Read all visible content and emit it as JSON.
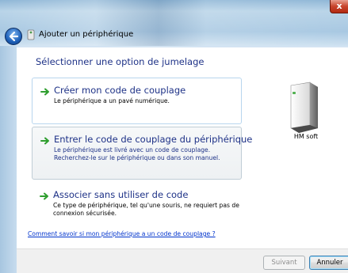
{
  "window": {
    "title": "Ajouter un périphérique",
    "close_glyph": "x"
  },
  "page": {
    "heading": "Sélectionner une option de jumelage"
  },
  "options": [
    {
      "title": "Créer mon code de couplage",
      "desc": "Le périphérique a un pavé numérique."
    },
    {
      "title": "Entrer le code de couplage du périphérique",
      "desc": "Le périphérique est livré avec un code de couplage. Recherchez-le sur le périphérique ou dans son manuel."
    },
    {
      "title": "Associer sans utiliser de code",
      "desc": "Ce type de périphérique, tel qu'une souris, ne requiert pas de connexion sécurisée."
    }
  ],
  "device": {
    "label": "HM soft",
    "icon": "device-tower-icon"
  },
  "help_link": "Comment savoir si mon périphérique a un code de couplage ?",
  "buttons": {
    "next": "Suivant",
    "cancel": "Annuler"
  },
  "colors": {
    "heading_blue": "#1e3287",
    "link_blue": "#0033cc",
    "arrow_green": "#2e9e2e"
  }
}
